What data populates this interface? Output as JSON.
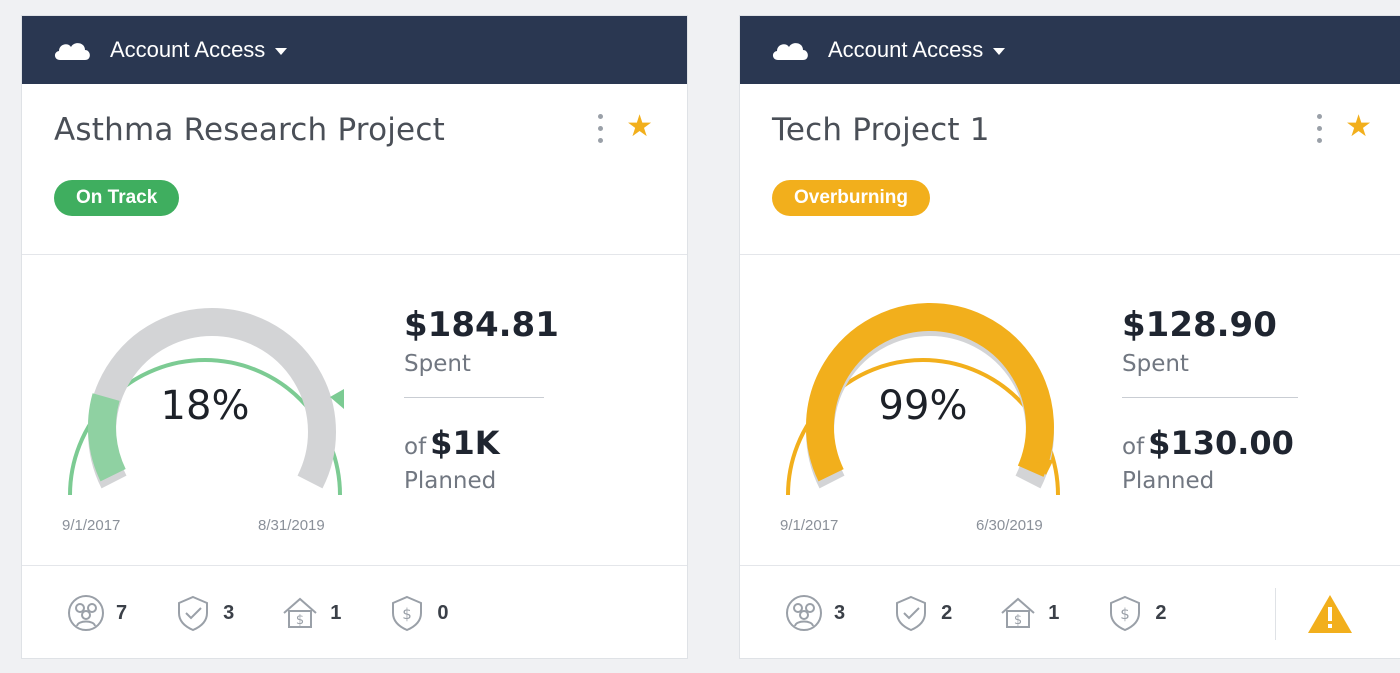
{
  "colors": {
    "header_bg": "#2a3751",
    "on_track": "#3fae5f",
    "overburning": "#f2af1c",
    "gauge_track": "#d3d4d6",
    "star": "#f2af1c",
    "warning": "#f2af1c"
  },
  "cards": [
    {
      "header_title": "Account Access",
      "project_title": "Asthma Research Project",
      "status": "On Track",
      "status_color": "#3fae5f",
      "percent_text": "18%",
      "percent": 18,
      "start_date": "9/1/2017",
      "end_date": "8/31/2019",
      "spent_amount": "$184.81",
      "spent_label": "Spent",
      "of_label": "of",
      "planned_amount": "$1K",
      "planned_label": "Planned",
      "stats": {
        "people": "7",
        "tasks": "3",
        "billing": "1",
        "funds": "0"
      },
      "warning": false
    },
    {
      "header_title": "Account Access",
      "project_title": "Tech Project 1",
      "status": "Overburning",
      "status_color": "#f2af1c",
      "percent_text": "99%",
      "percent": 99,
      "start_date": "9/1/2017",
      "end_date": "6/30/2019",
      "spent_amount": "$128.90",
      "spent_label": "Spent",
      "of_label": "of",
      "planned_amount": "$130.00",
      "planned_label": "Planned",
      "stats": {
        "people": "3",
        "tasks": "2",
        "billing": "1",
        "funds": "2"
      },
      "warning": true
    }
  ]
}
